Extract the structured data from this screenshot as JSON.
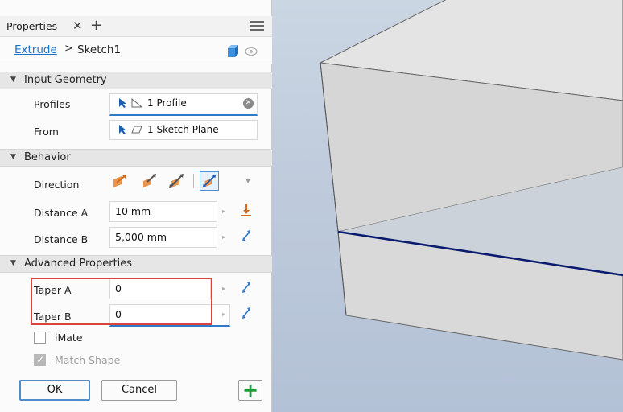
{
  "panel": {
    "tab_label": "Properties",
    "close_glyph": "✕",
    "add_glyph": "+",
    "menu_icon": "hamburger-icon"
  },
  "breadcrumb": {
    "feature": "Extrude",
    "separator": ">",
    "sketch": "Sketch1"
  },
  "sections": {
    "input_geometry": "Input Geometry",
    "behavior": "Behavior",
    "advanced": "Advanced Properties"
  },
  "input_geometry": {
    "profiles_label": "Profiles",
    "profiles_value": "1 Profile",
    "from_label": "From",
    "from_value": "1 Sketch Plane"
  },
  "behavior": {
    "direction_label": "Direction",
    "direction_options": [
      "default-direction",
      "flipped-direction",
      "symmetric-direction",
      "asymmetric-direction"
    ],
    "direction_selected": "asymmetric-direction",
    "distance_a_label": "Distance A",
    "distance_a_value": "10 mm",
    "distance_b_label": "Distance B",
    "distance_b_value": "5,000 mm"
  },
  "advanced": {
    "taper_a_label": "Taper A",
    "taper_a_value": "0",
    "taper_b_label": "Taper B",
    "taper_b_value": "0",
    "imate_label": "iMate",
    "imate_checked": false,
    "match_shape_label": "Match Shape",
    "match_shape_checked": true,
    "match_shape_disabled": true
  },
  "buttons": {
    "ok": "OK",
    "cancel": "Cancel",
    "add": "+"
  },
  "colors": {
    "accent": "#1a73c9",
    "highlight": "#d9453d",
    "add_green": "#1f9a3a",
    "edge_line": "#0a1a6e"
  }
}
